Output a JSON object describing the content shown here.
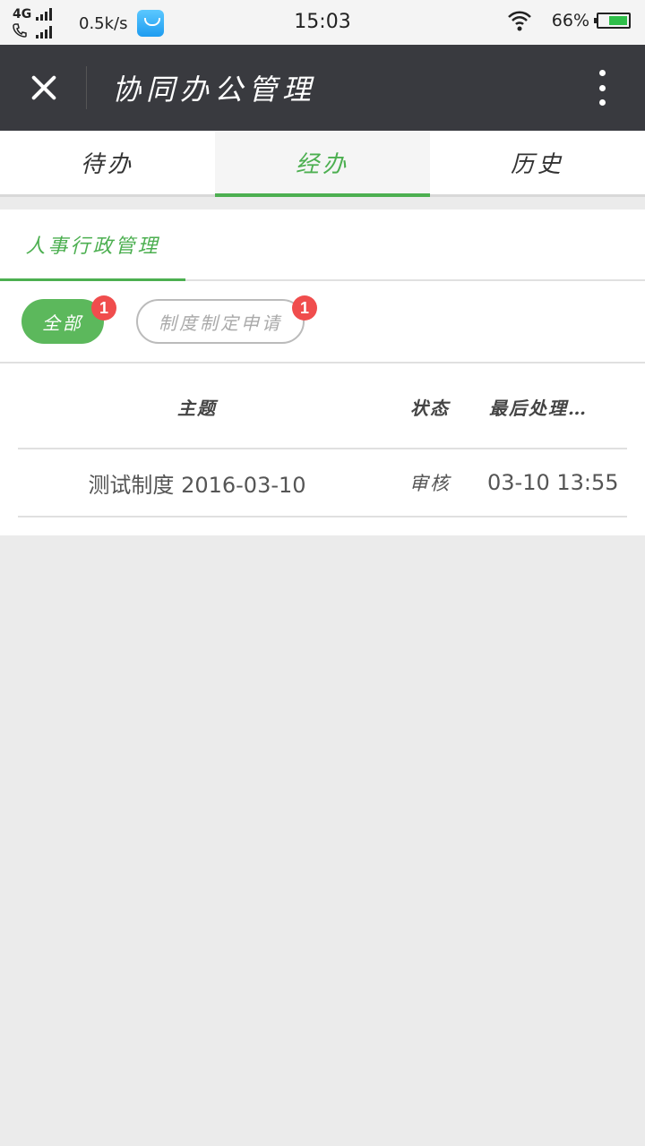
{
  "status_bar": {
    "network": "4G",
    "speed": "0.5k/s",
    "time": "15:03",
    "battery": "66%",
    "battery_level": 0.66,
    "icons": [
      "signal-icon",
      "phone-icon",
      "app-store-icon",
      "wifi-icon",
      "battery-icon"
    ]
  },
  "header": {
    "title": "协同办公管理",
    "close_icon": "close-icon",
    "more_icon": "more-vertical-icon"
  },
  "tabs": [
    {
      "label": "待办",
      "active": false
    },
    {
      "label": "经办",
      "active": true
    },
    {
      "label": "历史",
      "active": false
    }
  ],
  "category": {
    "label": "人事行政管理"
  },
  "filters": [
    {
      "label": "全部",
      "badge": "1",
      "selected": true
    },
    {
      "label": "制度制定申请",
      "badge": "1",
      "selected": false
    }
  ],
  "table": {
    "headers": {
      "subject": "主题",
      "status": "状态",
      "last": "最后处理…"
    },
    "rows": [
      {
        "subject": "测试制度 2016-03-10",
        "status": "审核",
        "last": "03-10 13:55"
      }
    ]
  },
  "colors": {
    "accent": "#4caf50",
    "header_bg": "#393a3f",
    "badge": "#f04d4d"
  }
}
